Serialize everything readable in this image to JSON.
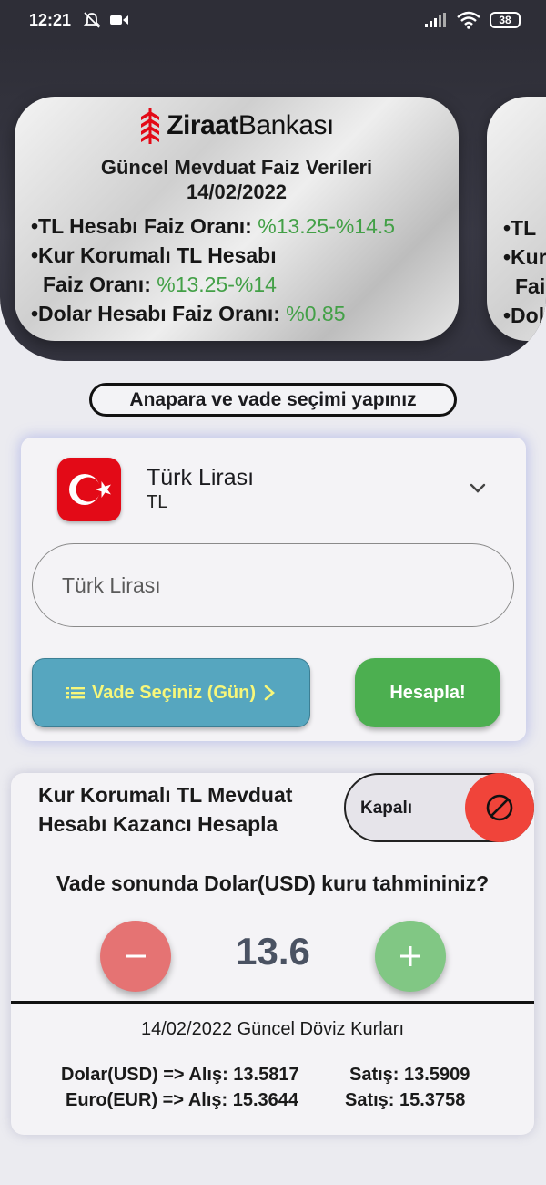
{
  "status_bar": {
    "time": "12:21",
    "battery": "38"
  },
  "rate_card": {
    "bank_name_bold": "Ziraat",
    "bank_name_regular": "Bankası",
    "title": "Güncel Mevduat Faiz Verileri",
    "date": "14/02/2022",
    "lines": [
      {
        "label": "•TL Hesabı Faiz Oranı: ",
        "value": "%13.25-%14.5"
      },
      {
        "label": "•Kur Korumalı TL Hesabı",
        "value": ""
      },
      {
        "label": "Faiz Oranı: ",
        "value": "%13.25-%14"
      },
      {
        "label": "•Dolar Hesabı Faiz Oranı: ",
        "value": "%0.85"
      }
    ],
    "peek_lines": [
      "•TL",
      "•Kur",
      "Fai",
      "•Dol"
    ]
  },
  "instruction": "Anapara ve vade seçimi yapınız",
  "currency": {
    "name": "Türk Lirası",
    "code": "TL",
    "amount_placeholder": "Türk Lirası",
    "amount_value": "",
    "vade_button": "Vade Seçiniz (Gün)",
    "hesapla_button": "Hesapla!"
  },
  "kur_korumali": {
    "title": "Kur Korumalı TL Mevduat Hesabı Kazancı Hesapla",
    "toggle_label": "Kapalı",
    "question": "Vade sonunda Dolar(USD) kuru tahmininiz?",
    "value": "13.6",
    "fx_title": "14/02/2022 Güncel Döviz Kurları",
    "rates": [
      {
        "pair": "Dolar(USD) => Alış: 13.5817",
        "sell": "Satış: 13.5909"
      },
      {
        "pair": "Euro(EUR) => Alış: 15.3644",
        "sell": "Satış: 15.3758"
      }
    ]
  },
  "colors": {
    "accent_green": "#43a047",
    "vade_button": "#56a6bf",
    "hesapla_button": "#4caf50",
    "toggle_off": "#f0443a",
    "minus": "#e57373",
    "plus": "#81c784"
  },
  "icons": [
    "mute-icon",
    "video-icon",
    "signal-icon",
    "wifi-icon",
    "battery-icon",
    "ziraat-logo-icon",
    "turkish-flag-icon",
    "chevron-down-icon",
    "list-icon",
    "chevron-right-icon",
    "block-icon",
    "minus-icon",
    "plus-icon"
  ]
}
